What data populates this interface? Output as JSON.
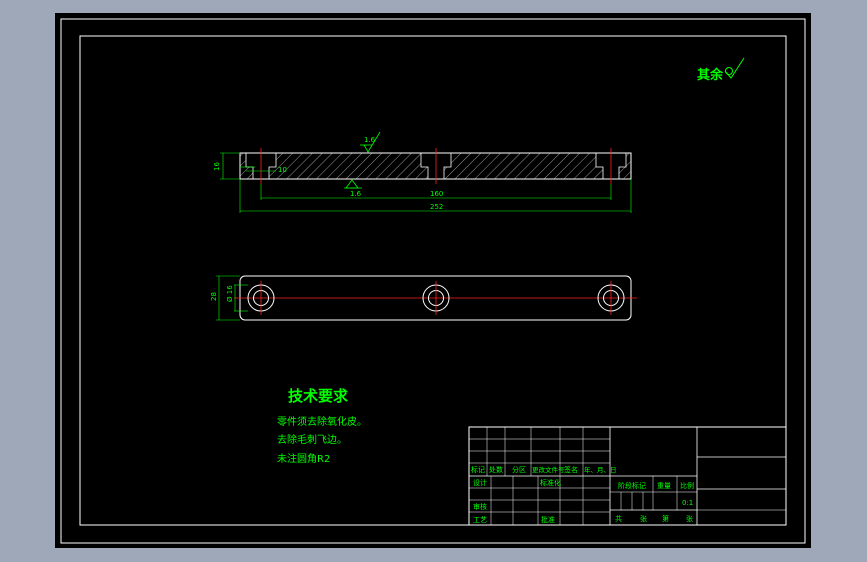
{
  "colors": {
    "background_outer": "#9ea8b8",
    "drawing_area": "#000000",
    "frame": "#ffffff",
    "annotation": "#00ff00",
    "centerline": "#ff2020",
    "hatch": "#ffffff"
  },
  "surface_note": "其余",
  "roughness": {
    "top": "1.6",
    "bottom": "1.6"
  },
  "dimensions": {
    "height_side": "16",
    "counterbore": "10",
    "hole_spacing": "160",
    "overall_length": "252",
    "plan_width": "28",
    "hole_dia": "Ø 16"
  },
  "tech_requirements": {
    "title": "技术要求",
    "items": [
      "零件须去除氧化皮。",
      "去除毛刺飞边。",
      "未注圆角R2"
    ]
  },
  "title_block": {
    "header_row": [
      "标记",
      "处数",
      "分区",
      "更改文件号",
      "签名",
      "年、月、日"
    ],
    "design": "设计",
    "standardize": "标准化",
    "review": "审核",
    "process": "工艺",
    "approve": "批准",
    "stage_mark": "阶段标记",
    "weight": "重量",
    "scale": "比例",
    "scale_value": "0:1",
    "sheet_total": "共",
    "sheet_unit1": "张",
    "sheet_no": "第",
    "sheet_unit2": "张"
  }
}
